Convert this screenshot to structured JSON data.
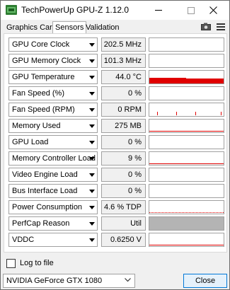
{
  "window": {
    "title": "TechPowerUp GPU-Z 1.12.0"
  },
  "tabs": [
    {
      "label": "Graphics Card"
    },
    {
      "label": "Sensors"
    },
    {
      "label": "Validation"
    }
  ],
  "sensors": [
    {
      "label": "GPU Core Clock",
      "value": "202.5 MHz",
      "graph": "none"
    },
    {
      "label": "GPU Memory Clock",
      "value": "101.3 MHz",
      "graph": "none"
    },
    {
      "label": "GPU Temperature",
      "value": "44.0 °C",
      "graph": "temp"
    },
    {
      "label": "Fan Speed (%)",
      "value": "0 %",
      "graph": "none"
    },
    {
      "label": "Fan Speed (RPM)",
      "value": "0 RPM",
      "graph": "ticks"
    },
    {
      "label": "Memory Used",
      "value": "275 MB",
      "graph": "baseline"
    },
    {
      "label": "GPU Load",
      "value": "0 %",
      "graph": "none"
    },
    {
      "label": "Memory Controller Load",
      "value": "9 %",
      "graph": "baseline"
    },
    {
      "label": "Video Engine Load",
      "value": "0 %",
      "graph": "none"
    },
    {
      "label": "Bus Interface Load",
      "value": "0 %",
      "graph": "none"
    },
    {
      "label": "Power Consumption",
      "value": "4.6 % TDP",
      "graph": "dotted"
    },
    {
      "label": "PerfCap Reason",
      "value": "Util",
      "graph": "gray"
    },
    {
      "label": "VDDC",
      "value": "0.6250 V",
      "graph": "baseline"
    }
  ],
  "footer": {
    "log_label": "Log to file",
    "log_checked": false,
    "gpu_selected": "NVIDIA GeForce GTX 1080",
    "close_label": "Close"
  },
  "colors": {
    "graph_red": "#e00000",
    "perfcap_gray": "#b4b4b4"
  },
  "icons": [
    "camera-icon",
    "hamburger-menu-icon",
    "minimize-icon",
    "maximize-icon",
    "close-icon"
  ]
}
